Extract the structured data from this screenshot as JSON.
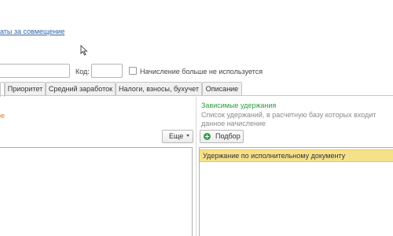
{
  "header": {
    "link_text": "аты за совмещение"
  },
  "form": {
    "code_label": "Код:",
    "name_value": "",
    "code_value": "",
    "no_longer_used_label": "Начисление больше не используется",
    "no_longer_used_checked": false
  },
  "tabs": [
    {
      "label": "Приоритет"
    },
    {
      "label": "Средний заработок"
    },
    {
      "label": "Налоги, взносы, бухучет"
    },
    {
      "label": "Описание"
    }
  ],
  "left_panel": {
    "heading": "ое",
    "more_button": "Еще"
  },
  "right_panel": {
    "title": "Зависимые удержания",
    "description": "Список удержаний, в расчетную базу которых входит данное начисление",
    "pick_button": "Подбор",
    "rows": [
      {
        "label": "Удержание по исполнительному документу"
      }
    ]
  },
  "colors": {
    "link": "#3366aa",
    "accent_orange": "#e07a2c",
    "accent_green": "#2e9b3f",
    "selected_row": "#f6e08a"
  }
}
